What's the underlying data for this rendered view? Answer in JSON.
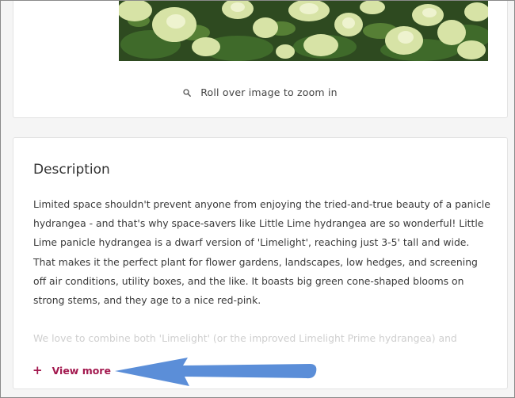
{
  "gallery": {
    "image_icon": "hydrangea-photo",
    "zoom_icon": "search-icon",
    "zoom_hint": "Roll over image to zoom in"
  },
  "description": {
    "title": "Description",
    "body": "Limited space shouldn't prevent anyone from enjoying the tried-and-true beauty of a panicle hydrangea - and that's why space-savers like Little Lime hydrangea are so wonderful! Little Lime panicle hydrangea is a dwarf version of 'Limelight', reaching just 3-5' tall and wide. That makes it the perfect plant for flower gardens, landscapes, low hedges, and screening off air conditions, utility boxes, and the like. It boasts big green cone-shaped blooms on strong stems, and they age to a nice red-pink.",
    "faded_line": "We love to combine both 'Limelight' (or the improved Limelight Prime hydrangea) and",
    "view_more_icon": "plus",
    "view_more_label": "View more"
  },
  "annotation": {
    "arrow_icon": "arrow-left-annotation",
    "arrow_color": "#5b8ed8"
  },
  "colors": {
    "accent": "#a3194f",
    "text": "#3a3a3a",
    "card_border": "#e3e3e3"
  }
}
